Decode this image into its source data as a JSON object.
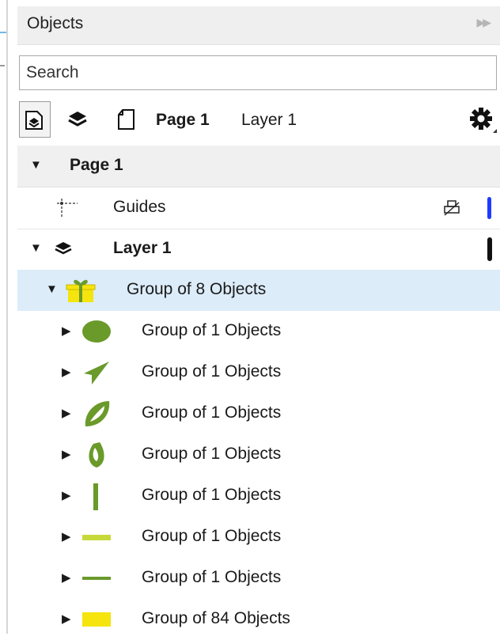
{
  "panel": {
    "title": "Objects",
    "collapse_icon": "double-chevron-right-icon"
  },
  "search": {
    "placeholder": "Search"
  },
  "toolbar": {
    "page_label": "Page 1",
    "layer_label": "Layer 1",
    "buttons": [
      "page-layer-view-icon",
      "layer-view-icon",
      "page-view-icon",
      "gear-icon"
    ]
  },
  "tree": {
    "page": {
      "label": "Page 1"
    },
    "guides": {
      "label": "Guides",
      "color": "#1f3bff"
    },
    "layer": {
      "label": "Layer 1",
      "color": "#111111"
    },
    "group": {
      "label": "Group of 8 Objects"
    },
    "children": [
      {
        "label": "Group of 1 Objects",
        "icon": "ellipse-shape-icon",
        "color": "#6a9a2a"
      },
      {
        "label": "Group of 1 Objects",
        "icon": "arrowhead-shape-icon",
        "color": "#6a9a2a"
      },
      {
        "label": "Group of 1 Objects",
        "icon": "leaf-shape-icon",
        "color": "#6a9a2a"
      },
      {
        "label": "Group of 1 Objects",
        "icon": "drop-shape-icon",
        "color": "#6a9a2a"
      },
      {
        "label": "Group of 1 Objects",
        "icon": "vertical-bar-shape-icon",
        "color": "#6a9a2a"
      },
      {
        "label": "Group of 1 Objects",
        "icon": "horizontal-bar-shape-icon",
        "color": "#c7d93a"
      },
      {
        "label": "Group of 1 Objects",
        "icon": "line-shape-icon",
        "color": "#6a9a2a"
      },
      {
        "label": "Group of 84 Objects",
        "icon": "rectangle-shape-icon",
        "color": "#f5e40d"
      }
    ]
  }
}
